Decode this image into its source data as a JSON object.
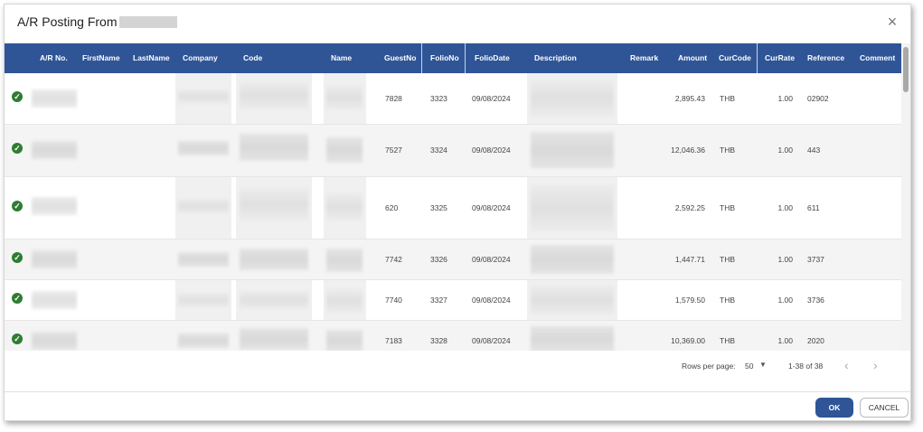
{
  "dialog": {
    "title": "A/R Posting From",
    "close_label": "×"
  },
  "table": {
    "columns": {
      "ar_no": "A/R No.",
      "first_name": "FirstName",
      "last_name": "LastName",
      "company": "Company",
      "code": "Code",
      "name": "Name",
      "guest_no": "GuestNo",
      "folio_no": "FolioNo",
      "folio_date": "FolioDate",
      "description": "Description",
      "remark": "Remark",
      "amount": "Amount",
      "cur_code": "CurCode",
      "cur_rate": "CurRate",
      "reference": "Reference",
      "comment": "Comment"
    },
    "rows": [
      {
        "status": "check-circle-icon",
        "guest_no": "7828",
        "folio_no": "3323",
        "folio_date": "09/08/2024",
        "amount": "2,895.43",
        "cur_code": "THB",
        "cur_rate": "1.00",
        "reference": "02902"
      },
      {
        "status": "check-circle-icon",
        "guest_no": "7527",
        "folio_no": "3324",
        "folio_date": "09/08/2024",
        "amount": "12,046.36",
        "cur_code": "THB",
        "cur_rate": "1.00",
        "reference": "443"
      },
      {
        "status": "check-circle-icon",
        "guest_no": "620",
        "folio_no": "3325",
        "folio_date": "09/08/2024",
        "amount": "2,592.25",
        "cur_code": "THB",
        "cur_rate": "1.00",
        "reference": "611"
      },
      {
        "status": "check-circle-icon",
        "guest_no": "7742",
        "folio_no": "3326",
        "folio_date": "09/08/2024",
        "amount": "1,447.71",
        "cur_code": "THB",
        "cur_rate": "1.00",
        "reference": "3737"
      },
      {
        "status": "check-circle-icon",
        "guest_no": "7740",
        "folio_no": "3327",
        "folio_date": "09/08/2024",
        "amount": "1,579.50",
        "cur_code": "THB",
        "cur_rate": "1.00",
        "reference": "3736"
      },
      {
        "status": "check-circle-icon",
        "guest_no": "7183",
        "folio_no": "3328",
        "folio_date": "09/08/2024",
        "amount": "10,369.00",
        "cur_code": "THB",
        "cur_rate": "1.00",
        "reference": "2020"
      }
    ]
  },
  "pagination": {
    "rows_per_page_label": "Rows per page:",
    "rows_per_page_value": "50",
    "range": "1-38 of 38",
    "prev": "‹",
    "next": "›"
  },
  "buttons": {
    "ok": "OK",
    "cancel": "CANCEL"
  },
  "colors": {
    "header_bg": "#2f5597",
    "check_green": "#2e7d32"
  }
}
